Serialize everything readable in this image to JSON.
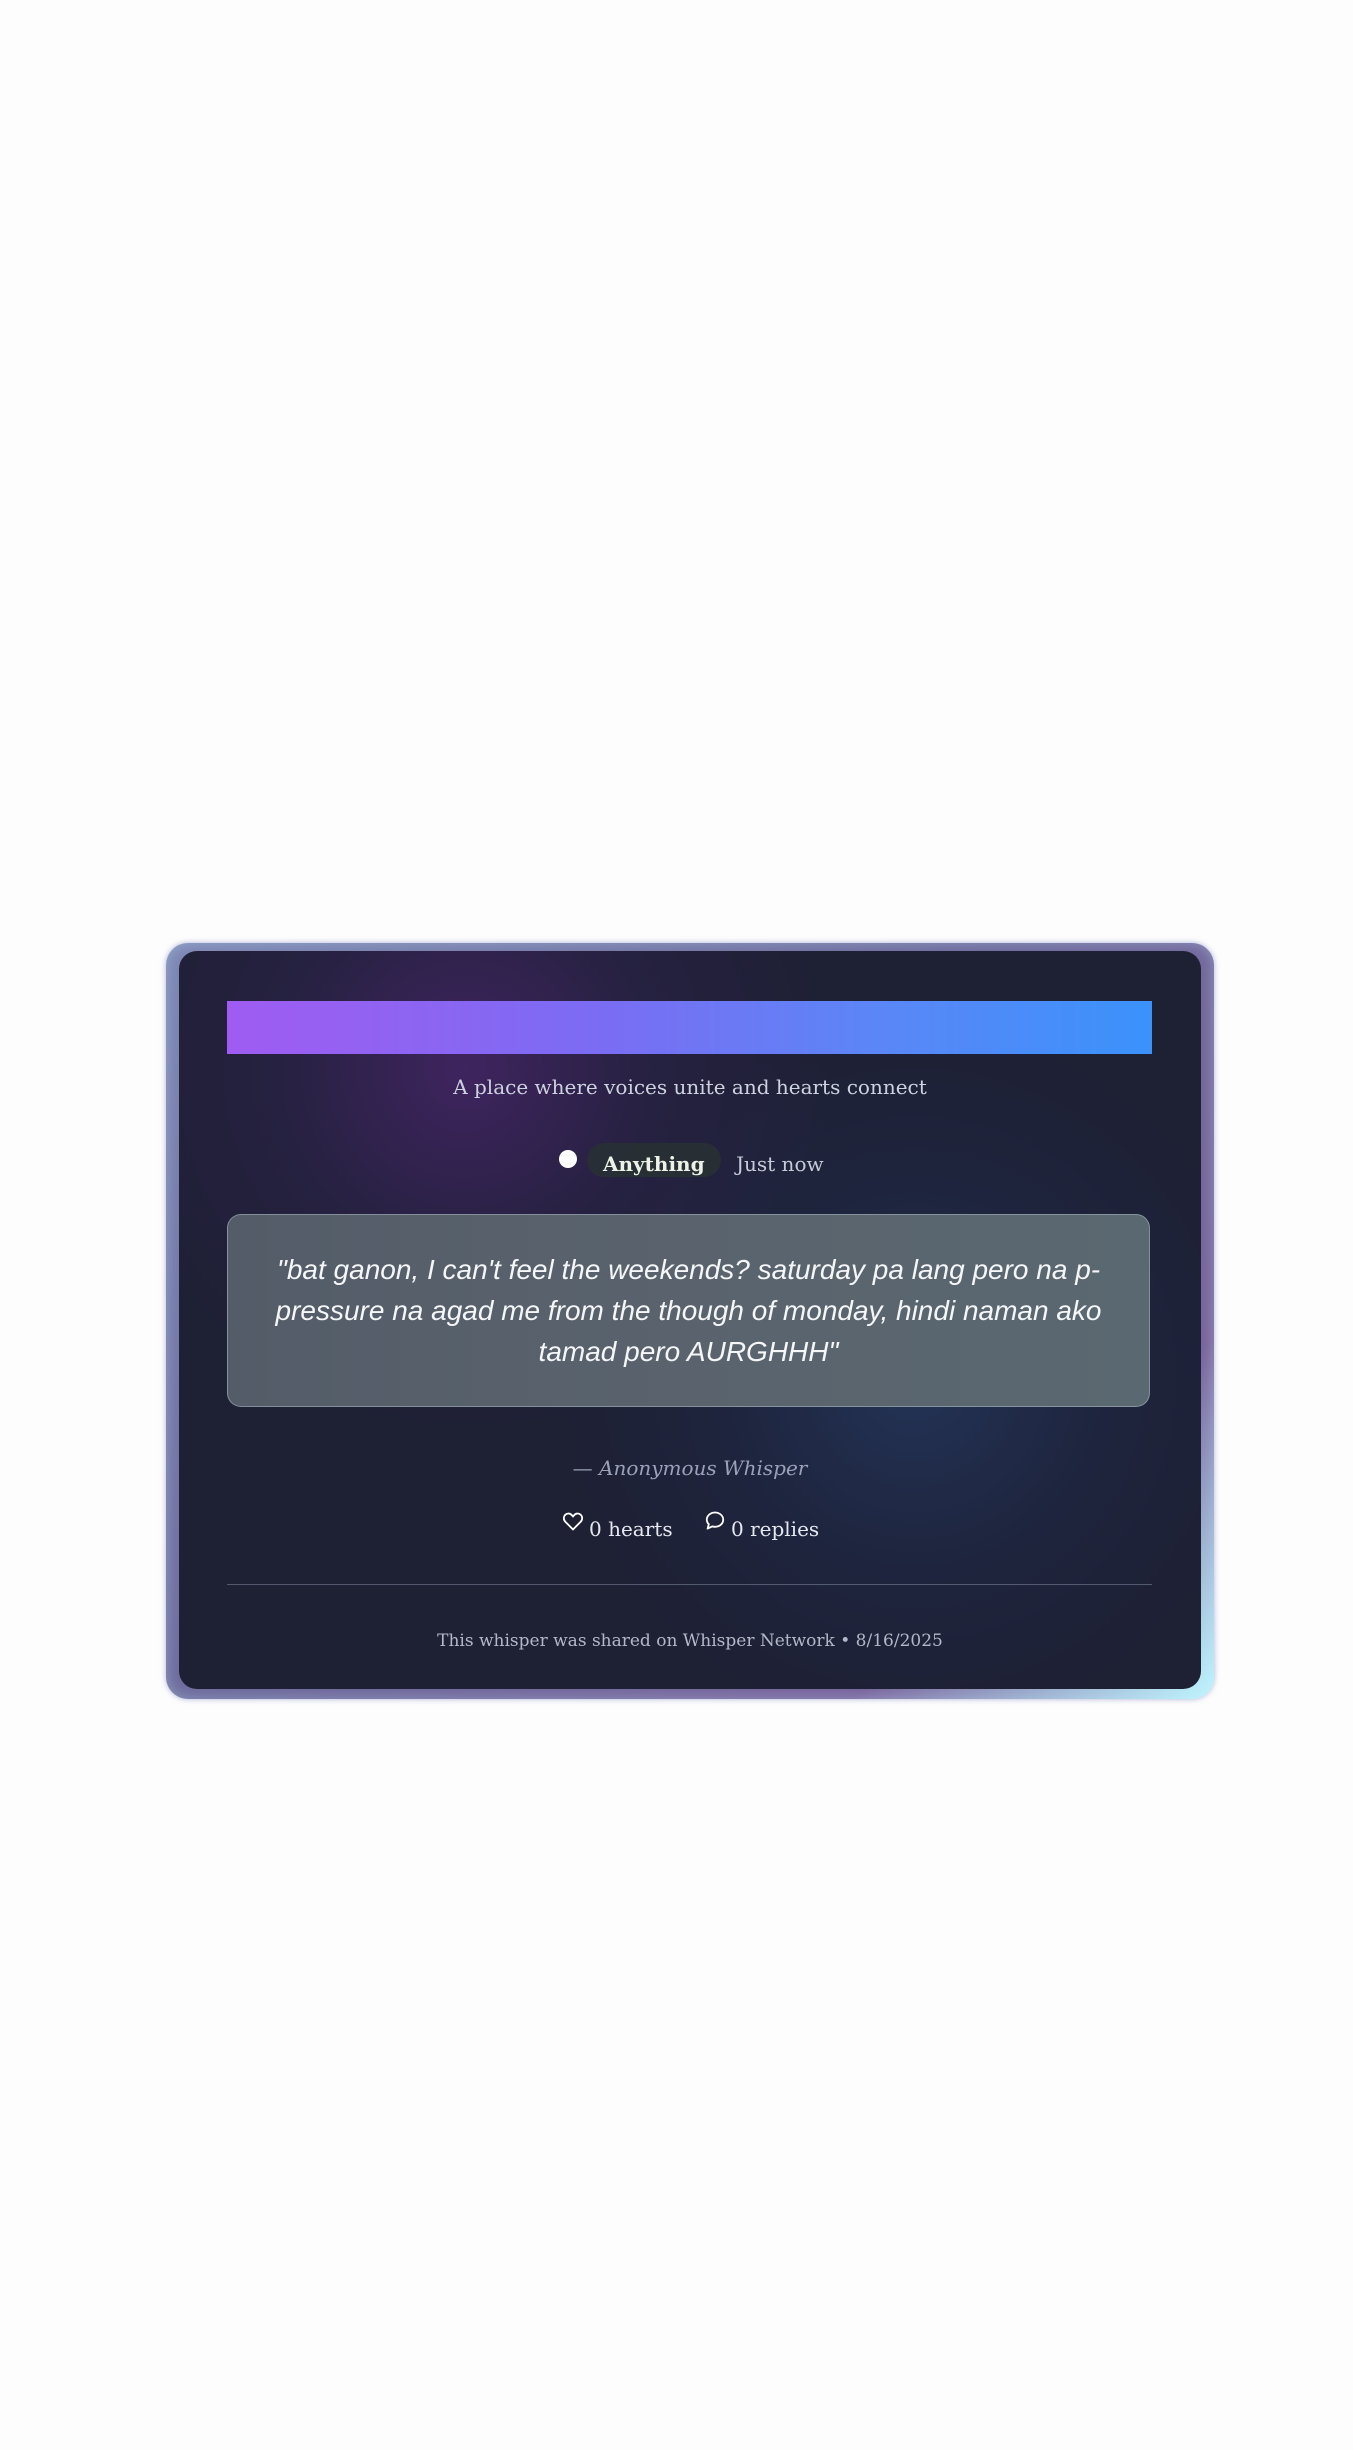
{
  "card": {
    "tagline": "A place where voices unite and hearts connect",
    "category_tag": "Anything",
    "timestamp": "Just now",
    "quote": "\"bat ganon, I can't feel the weekends? saturday pa lang pero na p-pressure na agad me from the though of monday, hindi naman ako tamad pero AURGHHH\"",
    "author": "— Anonymous Whisper",
    "hearts_label": "0 hearts",
    "replies_label": "0 replies",
    "footer": "This whisper was shared on Whisper Network • 8/16/2025"
  },
  "icons": {
    "status": "status-dot-icon",
    "hearts": "heart-icon",
    "replies": "speech-bubble-icon"
  },
  "colors": {
    "banner_start": "#a05cf2",
    "banner_end": "#3b92fb",
    "card_background": "#1e2034",
    "page_background": "#fdfdfd"
  }
}
